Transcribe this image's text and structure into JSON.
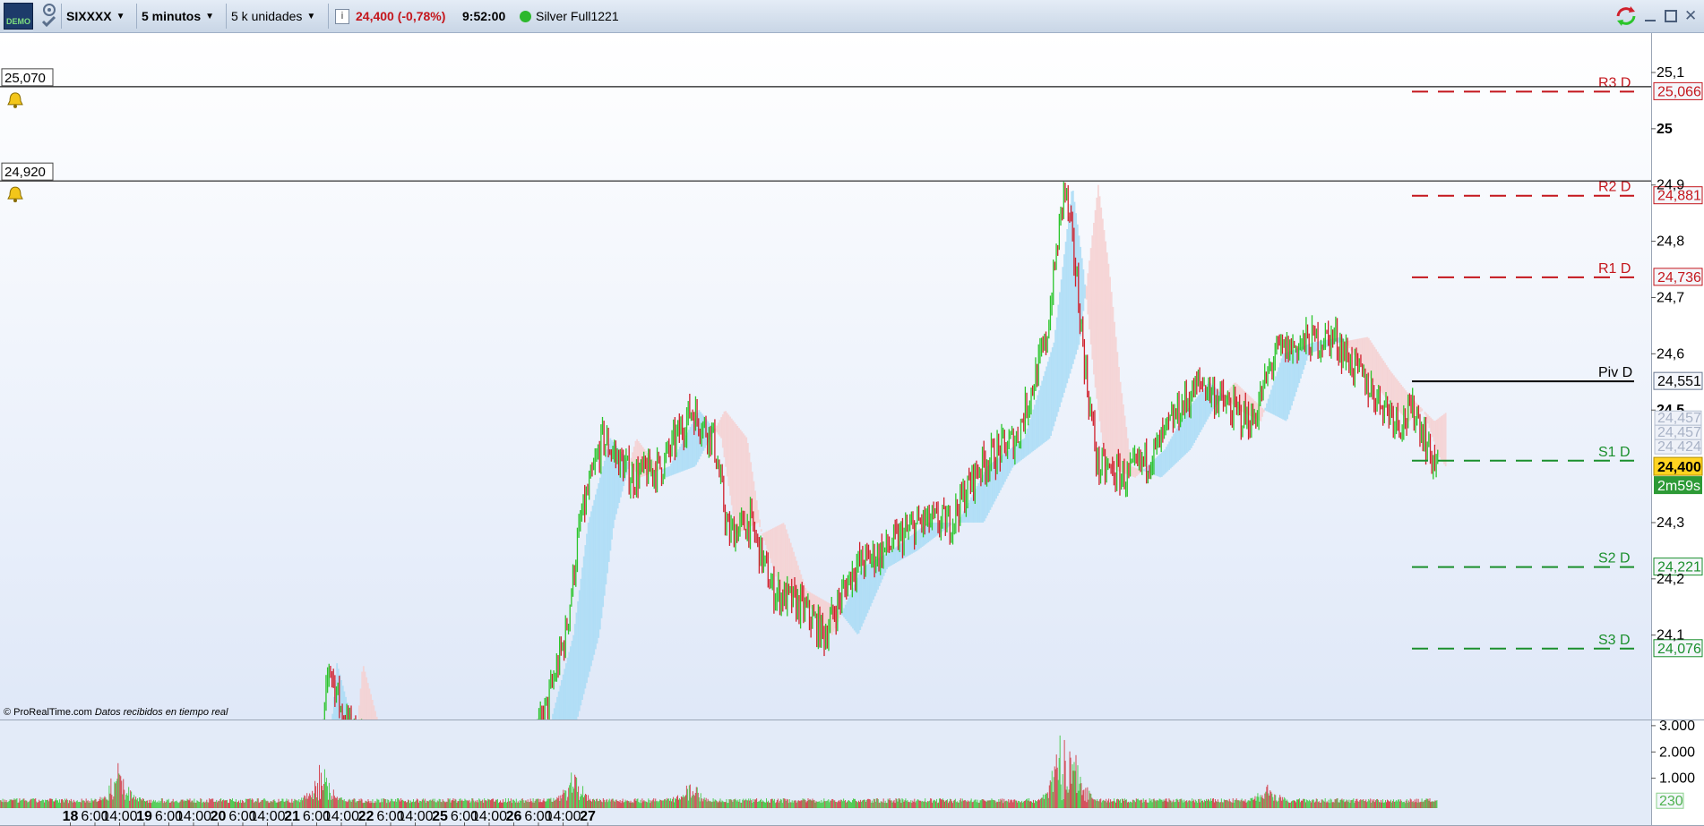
{
  "toolbar": {
    "demo_badge": "DEMO",
    "instrument": "SIXXXX",
    "timeframe": "5 minutos",
    "units": "5 k unidades",
    "price_change": "24,400 (-0,78%)",
    "time": "9:52:00",
    "account": "Silver Full1221"
  },
  "colors": {
    "up_candle": "#2bc52b",
    "down_candle": "#d0202c",
    "resistance": "#c4161c",
    "support": "#1a8f2c",
    "cloud_bull": "#a9dcf6",
    "cloud_bear": "#f6d0d0",
    "current_price_bg": "#ffd320"
  },
  "alerts": [
    {
      "label": "25,070",
      "value": 25.07
    },
    {
      "label": "24,920",
      "value": 24.92
    }
  ],
  "footer_note": {
    "brand": "© ProRealTime.com",
    "text": "Datos recibidos en tiempo real"
  },
  "countdown": "2m59s",
  "current_price": {
    "label": "24,400",
    "value": 24.4
  },
  "hidden_axis_labels": [
    "24,457",
    "24,457",
    "24,424"
  ],
  "chart_data": [
    {
      "type": "line",
      "title": "SIXXXX 5 minutos",
      "ylim": [
        23.95,
        25.17
      ],
      "y_ticks": [
        {
          "value": 25.1,
          "label": "25,1"
        },
        {
          "value": 25.0,
          "label": "25"
        },
        {
          "value": 24.9,
          "label": "24,9"
        },
        {
          "value": 24.8,
          "label": "24,8"
        },
        {
          "value": 24.7,
          "label": "24,7"
        },
        {
          "value": 24.6,
          "label": "24,6"
        },
        {
          "value": 24.5,
          "label": "24,5"
        },
        {
          "value": 24.3,
          "label": "24,3"
        },
        {
          "value": 24.2,
          "label": "24,2"
        },
        {
          "value": 24.1,
          "label": "24,1"
        }
      ],
      "x_ticks": [
        "18",
        "6:00",
        "14:00",
        "19",
        "6:00",
        "14:00",
        "20",
        "6:00",
        "14:00",
        "21",
        "6:00",
        "14:00",
        "22",
        "6:00",
        "14:00",
        "25",
        "6:00",
        "14:00",
        "26",
        "6:00",
        "14:00",
        "27"
      ],
      "pivots": [
        {
          "name": "R3 D",
          "value": 25.066,
          "label": "25,066",
          "kind": "resistance"
        },
        {
          "name": "R2 D",
          "value": 24.881,
          "label": "24,881",
          "kind": "resistance"
        },
        {
          "name": "R1 D",
          "value": 24.736,
          "label": "24,736",
          "kind": "resistance"
        },
        {
          "name": "Piv D",
          "value": 24.551,
          "label": "24,551",
          "kind": "pivot"
        },
        {
          "name": "S1 D",
          "value": 24.41,
          "label": "",
          "kind": "support"
        },
        {
          "name": "S2 D",
          "value": 24.221,
          "label": "24,221",
          "kind": "support"
        },
        {
          "name": "S3 D",
          "value": 24.076,
          "label": "24,076",
          "kind": "support"
        }
      ],
      "price_path": [
        {
          "x": 0,
          "y": 23.5
        },
        {
          "x": 4.4,
          "y": 23.9
        },
        {
          "x": 4.5,
          "y": 24.05
        },
        {
          "x": 4.7,
          "y": 23.95
        },
        {
          "x": 5.0,
          "y": 23.9
        },
        {
          "x": 7.0,
          "y": 23.85
        },
        {
          "x": 7.4,
          "y": 23.95
        },
        {
          "x": 7.7,
          "y": 24.1
        },
        {
          "x": 7.9,
          "y": 24.3
        },
        {
          "x": 8.2,
          "y": 24.45
        },
        {
          "x": 8.6,
          "y": 24.38
        },
        {
          "x": 9.0,
          "y": 24.4
        },
        {
          "x": 9.4,
          "y": 24.5
        },
        {
          "x": 9.7,
          "y": 24.45
        },
        {
          "x": 9.9,
          "y": 24.28
        },
        {
          "x": 10.2,
          "y": 24.3
        },
        {
          "x": 10.5,
          "y": 24.18
        },
        {
          "x": 10.9,
          "y": 24.15
        },
        {
          "x": 11.2,
          "y": 24.1
        },
        {
          "x": 11.6,
          "y": 24.22
        },
        {
          "x": 12.0,
          "y": 24.25
        },
        {
          "x": 12.5,
          "y": 24.3
        },
        {
          "x": 12.9,
          "y": 24.3
        },
        {
          "x": 13.3,
          "y": 24.4
        },
        {
          "x": 13.8,
          "y": 24.45
        },
        {
          "x": 14.2,
          "y": 24.62
        },
        {
          "x": 14.45,
          "y": 24.9
        },
        {
          "x": 14.6,
          "y": 24.75
        },
        {
          "x": 14.75,
          "y": 24.55
        },
        {
          "x": 14.9,
          "y": 24.4
        },
        {
          "x": 15.3,
          "y": 24.38
        },
        {
          "x": 15.7,
          "y": 24.43
        },
        {
          "x": 16.0,
          "y": 24.5
        },
        {
          "x": 16.3,
          "y": 24.55
        },
        {
          "x": 16.7,
          "y": 24.5
        },
        {
          "x": 17.0,
          "y": 24.48
        },
        {
          "x": 17.3,
          "y": 24.6
        },
        {
          "x": 17.7,
          "y": 24.62
        },
        {
          "x": 18.1,
          "y": 24.63
        },
        {
          "x": 18.4,
          "y": 24.57
        },
        {
          "x": 18.7,
          "y": 24.52
        },
        {
          "x": 19.0,
          "y": 24.48
        },
        {
          "x": 19.2,
          "y": 24.5
        },
        {
          "x": 19.4,
          "y": 24.42
        },
        {
          "x": 19.5,
          "y": 24.4
        }
      ],
      "volume": {
        "y_ticks": [
          {
            "value": 3000,
            "label": "3.000"
          },
          {
            "value": 2000,
            "label": "2.000"
          },
          {
            "value": 1000,
            "label": "1.000"
          }
        ],
        "ylim": [
          0,
          3200
        ],
        "last_value": {
          "value": 230,
          "label": "230"
        },
        "peaks": [
          {
            "x": 1.65,
            "value": 1700
          },
          {
            "x": 4.4,
            "value": 1900
          },
          {
            "x": 7.8,
            "value": 1500
          },
          {
            "x": 9.4,
            "value": 1200
          },
          {
            "x": 14.4,
            "value": 3000
          },
          {
            "x": 14.6,
            "value": 1900
          },
          {
            "x": 17.2,
            "value": 900
          }
        ]
      }
    }
  ]
}
